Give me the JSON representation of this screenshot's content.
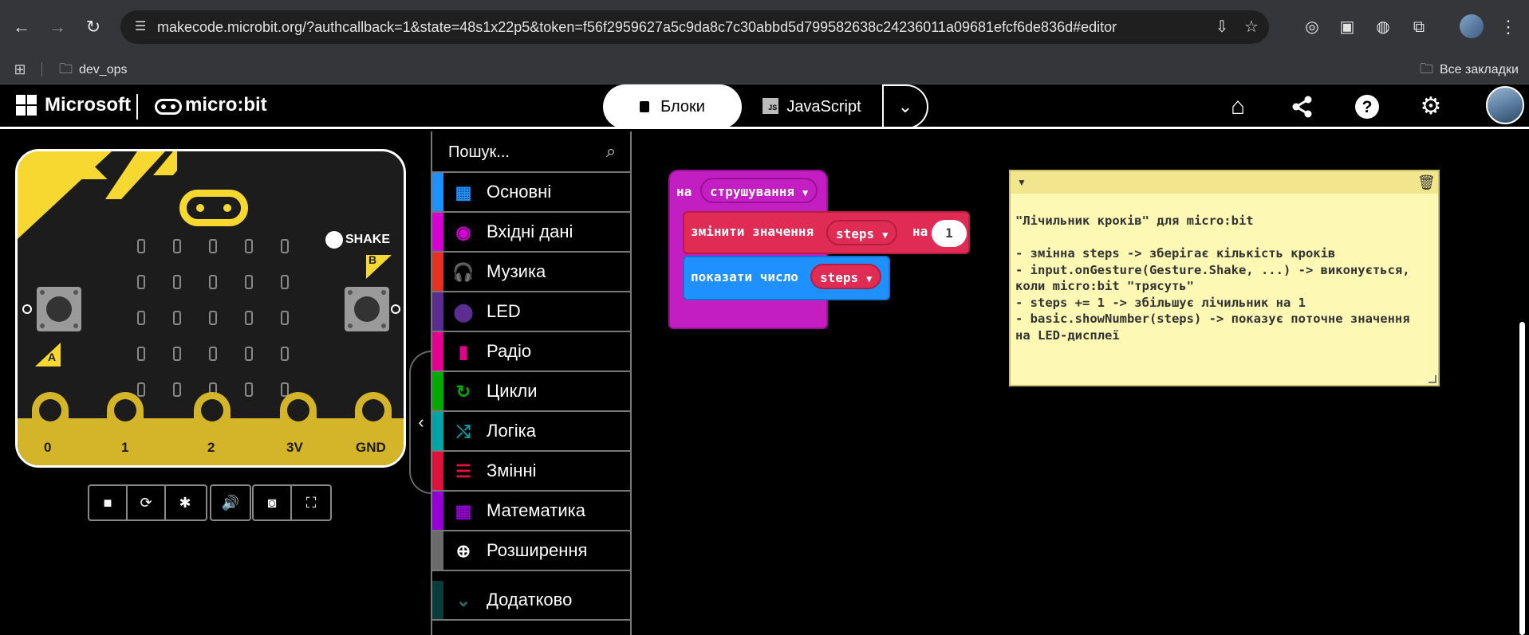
{
  "browser": {
    "url": "makecode.microbit.org/?authcallback=1&state=48s1x22p5&token=f56f2959627a5c9da8c7c30abbd5d799582638c24236011a09681efcf6de836d#editor",
    "bookmarks": [
      {
        "label": "dev_ops"
      },
      {
        "label": "Все закладки"
      }
    ],
    "icons": {
      "back": "arrow-left",
      "forward": "arrow-right",
      "reload": "reload",
      "site_info": "tune",
      "install": "install-app",
      "star": "star",
      "menu": "more-vert"
    }
  },
  "header": {
    "microsoft_label": "Microsoft",
    "microbit_label": "micro:bit",
    "tabs": [
      {
        "label": "Блоки",
        "active": true
      },
      {
        "label": "JavaScript",
        "active": false
      }
    ],
    "js_badge": "JS",
    "icons": [
      "home-icon",
      "share-icon",
      "help-icon",
      "settings-icon"
    ]
  },
  "simulator": {
    "shake_label": "SHAKE",
    "button_a": "A",
    "button_b": "B",
    "pins": [
      "0",
      "1",
      "2",
      "3V",
      "GND"
    ],
    "controls": [
      "stop",
      "restart",
      "debug",
      "mute",
      "screenshot",
      "fullscreen"
    ]
  },
  "toolbox": {
    "search_placeholder": "Пошук...",
    "categories": [
      {
        "label": "Основні",
        "color": "#1e90ff",
        "icon": "grid"
      },
      {
        "label": "Вхідні дані",
        "color": "#d400d4",
        "icon": "target"
      },
      {
        "label": "Музика",
        "color": "#e63022",
        "icon": "headphones"
      },
      {
        "label": "LED",
        "color": "#5c2d91",
        "icon": "toggle"
      },
      {
        "label": "Радіо",
        "color": "#e3008c",
        "icon": "signal"
      },
      {
        "label": "Цикли",
        "color": "#00aa00",
        "icon": "refresh"
      },
      {
        "label": "Логіка",
        "color": "#00a4a6",
        "icon": "shuffle"
      },
      {
        "label": "Змінні",
        "color": "#dc143c",
        "icon": "lines"
      },
      {
        "label": "Математика",
        "color": "#9400d3",
        "icon": "calculator"
      },
      {
        "label": "Розширення",
        "color": "#6b6b6b",
        "icon": "plus-circle"
      },
      {
        "label": "Додатково",
        "color": "#0b3b3b",
        "icon": "chevron-down"
      }
    ]
  },
  "workspace": {
    "hat_block": {
      "prefix": "на",
      "event": "струшування"
    },
    "change_block": {
      "label": "змінити значення",
      "variable": "steps",
      "by": "на",
      "value": "1"
    },
    "show_block": {
      "label": "показати число",
      "variable": "steps"
    },
    "comment": {
      "text": "\"Лічильник кроків\" для micro:bit\n\n- змінна steps -> зберігає кількість кроків\n- input.onGesture(Gesture.Shake, ...) -> виконується,\nколи micro:bit \"трясуть\"\n- steps += 1 -> збільшує лічильник на 1\n- basic.showNumber(steps) -> показує поточне значення\nна LED-дисплеї"
    }
  }
}
